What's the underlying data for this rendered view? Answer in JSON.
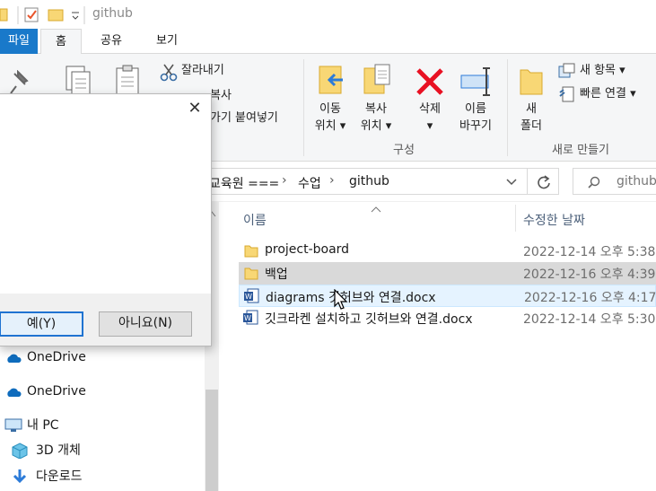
{
  "titlebar": {
    "title": "github"
  },
  "tabs": {
    "file": "파일",
    "home": "홈",
    "share": "공유",
    "view": "보기"
  },
  "ribbon": {
    "cut": "잘라내기",
    "copy_path": "복사",
    "paste_shortcut": "가기 붙여넣기",
    "move_to": [
      "이동",
      "위치 ▾"
    ],
    "copy_to": [
      "복사",
      "위치 ▾"
    ],
    "delete": [
      "삭제",
      "▾"
    ],
    "rename": [
      "이름",
      "바꾸기"
    ],
    "organize_group": "구성",
    "new_folder": [
      "새",
      "폴더"
    ],
    "new_item": "새 항목 ▾",
    "easy_access": "빠른 연결 ▾",
    "new_group": "새로 만들기"
  },
  "address": {
    "crumbs": [
      "교육원 ===",
      "수업",
      "github"
    ],
    "search_placeholder": "github"
  },
  "columns": {
    "name": "이름",
    "date": "수정한 날짜"
  },
  "files": [
    {
      "name": "project-board",
      "date": "2022-12-14 오후 5:38",
      "type": "folder"
    },
    {
      "name": "백업",
      "date": "2022-12-16 오후 4:39",
      "type": "folder"
    },
    {
      "name": "diagrams 깃허브와 연결.docx",
      "date": "2022-12-16 오후 4:17",
      "type": "docx"
    },
    {
      "name": "깃크라켄 설치하고 깃허브와 연결.docx",
      "date": "2022-12-14 오후 5:30",
      "type": "docx"
    }
  ],
  "nav": [
    {
      "label": "OneDrive",
      "icon": "cloud-icon"
    },
    {
      "label": "OneDrive",
      "icon": "cloud-icon"
    },
    {
      "label": "내 PC",
      "icon": "computer-icon"
    },
    {
      "label": "3D 개체",
      "icon": "cube-icon"
    },
    {
      "label": "다운로드",
      "icon": "download-icon"
    }
  ],
  "dialog": {
    "yes": "예(Y)",
    "no": "아니요(N)",
    "close": "✕"
  },
  "colors": {
    "accent": "#1979ca",
    "folder": "#f8d775",
    "word": "#2b579a",
    "delete": "#e81123"
  }
}
